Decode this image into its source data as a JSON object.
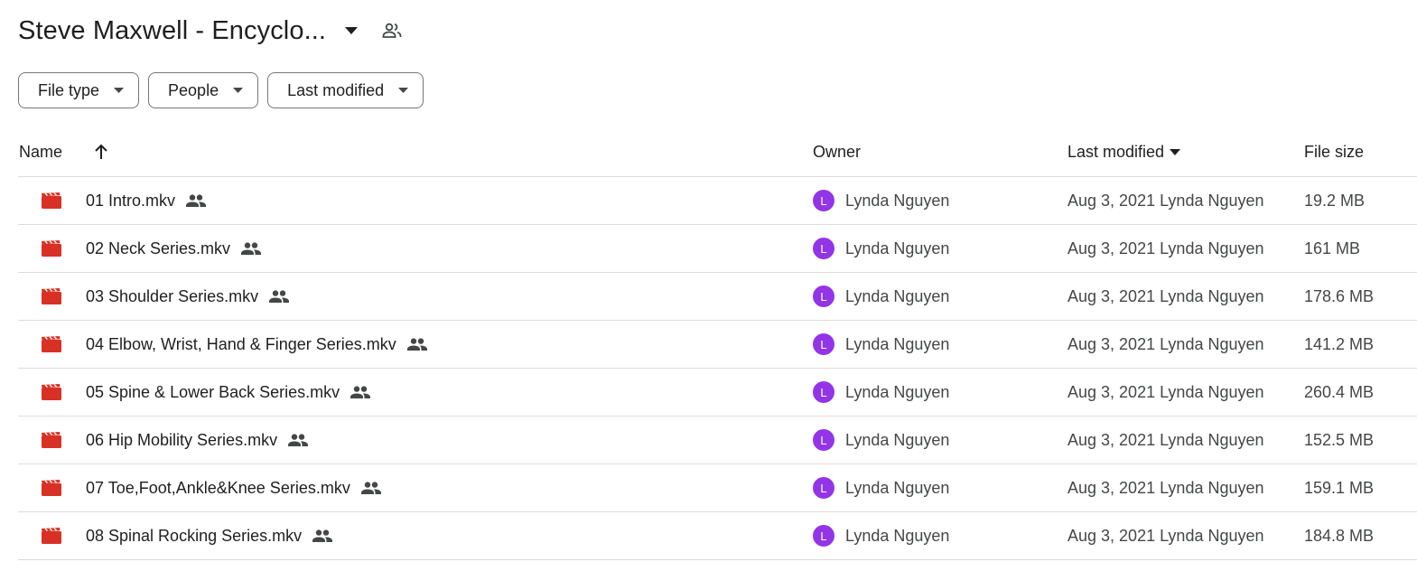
{
  "header": {
    "title": "Steve Maxwell - Encyclo...",
    "dropdown_icon": "arrow-drop-down-icon",
    "shared_icon": "shared-folder-people-icon"
  },
  "filters": [
    {
      "label": "File type"
    },
    {
      "label": "People"
    },
    {
      "label": "Last modified"
    }
  ],
  "table": {
    "columns": {
      "name": "Name",
      "owner": "Owner",
      "last_modified": "Last modified",
      "file_size": "File size"
    },
    "sort": {
      "column": "name",
      "direction": "ascending"
    },
    "rows": [
      {
        "name": "01 Intro.mkv",
        "owner": "Lynda Nguyen",
        "owner_initial": "L",
        "modified": "Aug 3, 2021 Lynda Nguyen",
        "size": "19.2 MB"
      },
      {
        "name": "02 Neck Series.mkv",
        "owner": "Lynda Nguyen",
        "owner_initial": "L",
        "modified": "Aug 3, 2021 Lynda Nguyen",
        "size": "161 MB"
      },
      {
        "name": "03 Shoulder Series.mkv",
        "owner": "Lynda Nguyen",
        "owner_initial": "L",
        "modified": "Aug 3, 2021 Lynda Nguyen",
        "size": "178.6 MB"
      },
      {
        "name": "04 Elbow, Wrist, Hand & Finger Series.mkv",
        "owner": "Lynda Nguyen",
        "owner_initial": "L",
        "modified": "Aug 3, 2021 Lynda Nguyen",
        "size": "141.2 MB"
      },
      {
        "name": "05 Spine & Lower Back Series.mkv",
        "owner": "Lynda Nguyen",
        "owner_initial": "L",
        "modified": "Aug 3, 2021 Lynda Nguyen",
        "size": "260.4 MB"
      },
      {
        "name": "06 Hip Mobility Series.mkv",
        "owner": "Lynda Nguyen",
        "owner_initial": "L",
        "modified": "Aug 3, 2021 Lynda Nguyen",
        "size": "152.5 MB"
      },
      {
        "name": "07 Toe,Foot,Ankle&Knee Series.mkv",
        "owner": "Lynda Nguyen",
        "owner_initial": "L",
        "modified": "Aug 3, 2021 Lynda Nguyen",
        "size": "159.1 MB"
      },
      {
        "name": "08 Spinal Rocking Series.mkv",
        "owner": "Lynda Nguyen",
        "owner_initial": "L",
        "modified": "Aug 3, 2021 Lynda Nguyen",
        "size": "184.8 MB"
      }
    ]
  },
  "colors": {
    "video_icon": "#d93025",
    "avatar": "#9334e6",
    "divider": "#dadce0",
    "chip_border": "#747775"
  }
}
